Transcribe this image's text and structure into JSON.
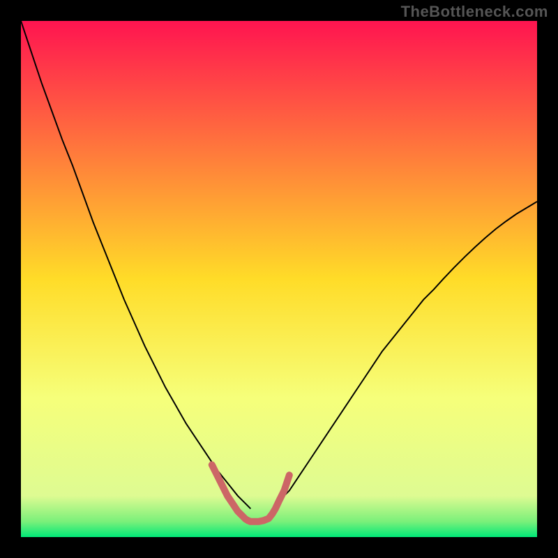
{
  "watermark": "TheBottleneck.com",
  "chart_data": {
    "type": "line",
    "title": "",
    "xlabel": "",
    "ylabel": "",
    "xlim": [
      0,
      100
    ],
    "ylim": [
      0,
      100
    ],
    "grid": false,
    "legend": false,
    "background_gradient": {
      "stops": [
        {
          "offset": 0.0,
          "color": "#ff1450"
        },
        {
          "offset": 0.5,
          "color": "#ffdc28"
        },
        {
          "offset": 0.73,
          "color": "#f6ff7a"
        },
        {
          "offset": 0.92,
          "color": "#defb92"
        },
        {
          "offset": 0.97,
          "color": "#7af07a"
        },
        {
          "offset": 1.0,
          "color": "#00e878"
        }
      ]
    },
    "series": [
      {
        "name": "left-curve",
        "stroke": "#000000",
        "stroke_width": 2,
        "x": [
          0,
          2,
          4,
          6,
          8,
          10,
          12,
          14,
          16,
          18,
          20,
          22,
          24,
          26,
          28,
          30,
          32,
          34,
          36,
          38,
          40,
          42,
          44,
          44.5
        ],
        "y": [
          100,
          94,
          88,
          82.5,
          77,
          72,
          66.5,
          61,
          56,
          51,
          46,
          41.5,
          37,
          33,
          29,
          25.5,
          22,
          19,
          16,
          13,
          10.5,
          8,
          6,
          5.5
        ]
      },
      {
        "name": "right-curve",
        "stroke": "#000000",
        "stroke_width": 2,
        "x": [
          49,
          50,
          52,
          54,
          56,
          58,
          60,
          62,
          64,
          66,
          68,
          70,
          72,
          74,
          76,
          78,
          80,
          82,
          84,
          86,
          88,
          90,
          92,
          94,
          96,
          98,
          100
        ],
        "y": [
          5.5,
          7,
          9,
          12,
          15,
          18,
          21,
          24,
          27,
          30,
          33,
          36,
          38.5,
          41,
          43.5,
          46,
          48,
          50.2,
          52.3,
          54.3,
          56.2,
          58,
          59.7,
          61.2,
          62.6,
          63.8,
          65
        ]
      },
      {
        "name": "valley-marker",
        "stroke": "#cc6666",
        "stroke_width": 10,
        "linecap": "round",
        "x": [
          37,
          38,
          39,
          40,
          41,
          42,
          43,
          43.5,
          44,
          44.5,
          45,
          46,
          47,
          48,
          48.7,
          49.3,
          50,
          51,
          52
        ],
        "y": [
          14,
          12,
          10,
          8,
          6.5,
          5,
          4,
          3.5,
          3.2,
          3,
          3,
          3,
          3.2,
          3.6,
          4.5,
          5.5,
          7,
          9,
          12
        ]
      }
    ]
  }
}
